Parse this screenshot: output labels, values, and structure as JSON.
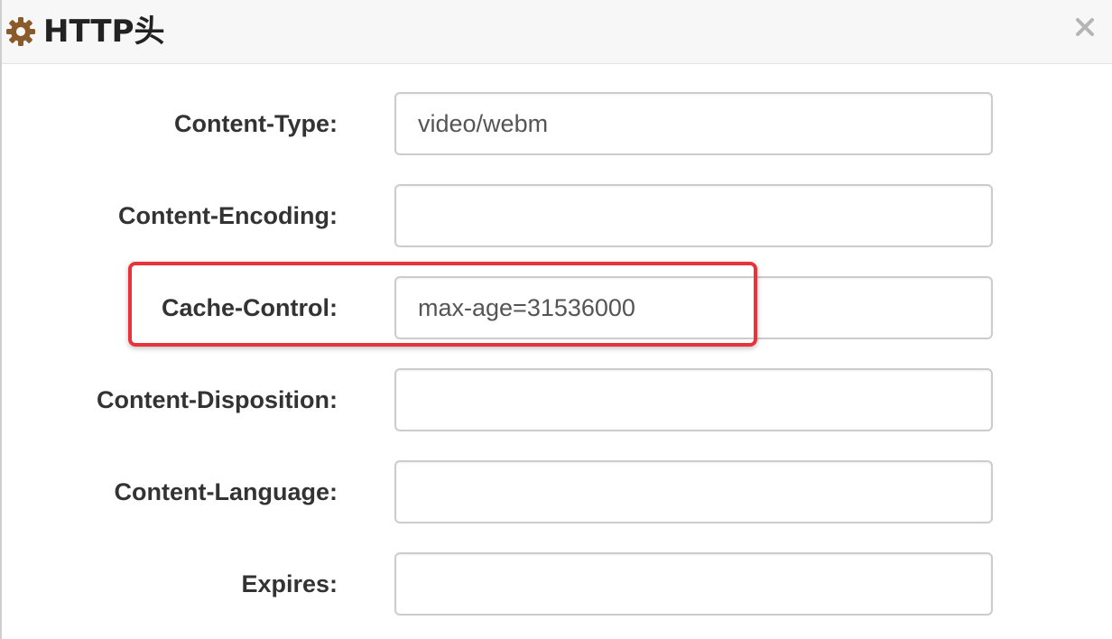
{
  "dialog": {
    "title": "HTTP头",
    "icon": "gear-icon",
    "close_icon": "close-icon"
  },
  "fields": [
    {
      "label": "Content-Type:",
      "value": "video/webm"
    },
    {
      "label": "Content-Encoding:",
      "value": ""
    },
    {
      "label": "Cache-Control:",
      "value": "max-age=31536000"
    },
    {
      "label": "Content-Disposition:",
      "value": ""
    },
    {
      "label": "Content-Language:",
      "value": ""
    },
    {
      "label": "Expires:",
      "value": ""
    }
  ],
  "colors": {
    "highlight": "#e8333a",
    "icon": "#8b5a2b"
  }
}
